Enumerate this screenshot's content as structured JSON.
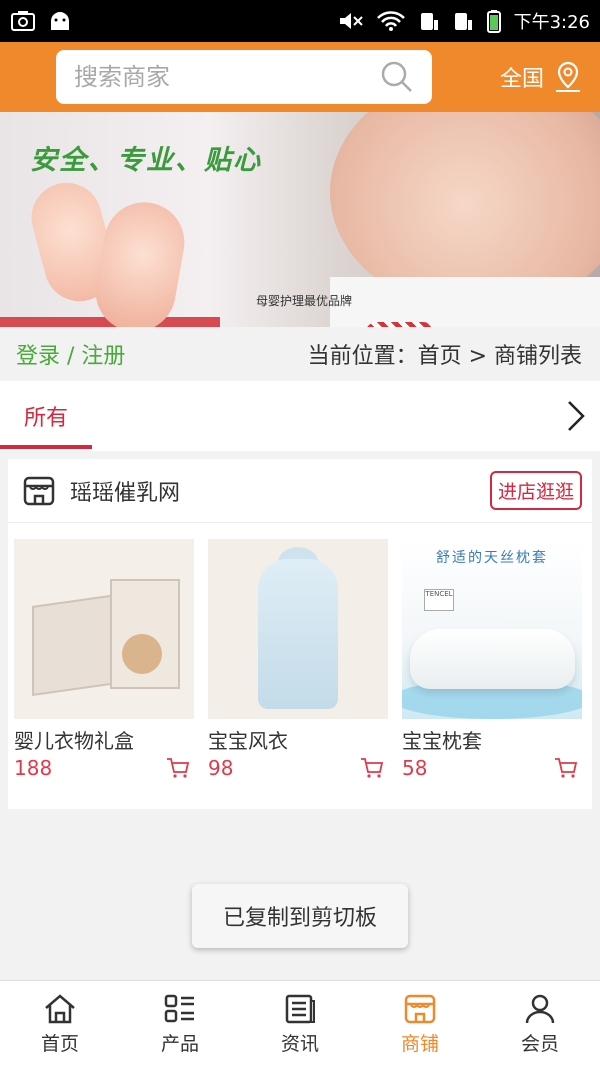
{
  "status_bar": {
    "time": "下午3:26"
  },
  "search": {
    "placeholder": "搜索商家",
    "region_label": "全国"
  },
  "banner": {
    "slogan": "安全、专业、贴心",
    "subtitle": "母婴护理最优品牌"
  },
  "account": {
    "login_register": "登录 / 注册"
  },
  "breadcrumb": {
    "text": "当前位置：首页 > 商铺列表"
  },
  "tabs": {
    "active": "所有"
  },
  "shop": {
    "name": "瑶瑶催乳网",
    "visit_label": "进店逛逛",
    "products": [
      {
        "name": "婴儿衣物礼盒",
        "price": "188"
      },
      {
        "name": "宝宝风衣",
        "price": "98"
      },
      {
        "name": "宝宝枕套",
        "price": "58",
        "image_caption": "舒适的天丝枕套",
        "image_tag": "TENCEL"
      }
    ]
  },
  "toast": {
    "message": "已复制到剪切板"
  },
  "bottom_nav": {
    "items": [
      {
        "label": "首页",
        "icon": "home-icon"
      },
      {
        "label": "产品",
        "icon": "grid-list-icon"
      },
      {
        "label": "资讯",
        "icon": "news-icon"
      },
      {
        "label": "商铺",
        "icon": "store-icon"
      },
      {
        "label": "会员",
        "icon": "user-icon"
      }
    ],
    "active_index": 3
  },
  "colors": {
    "accent": "#f0892b",
    "price": "#e03a4b",
    "tab_active": "#d7263d",
    "login": "#49a93a"
  }
}
